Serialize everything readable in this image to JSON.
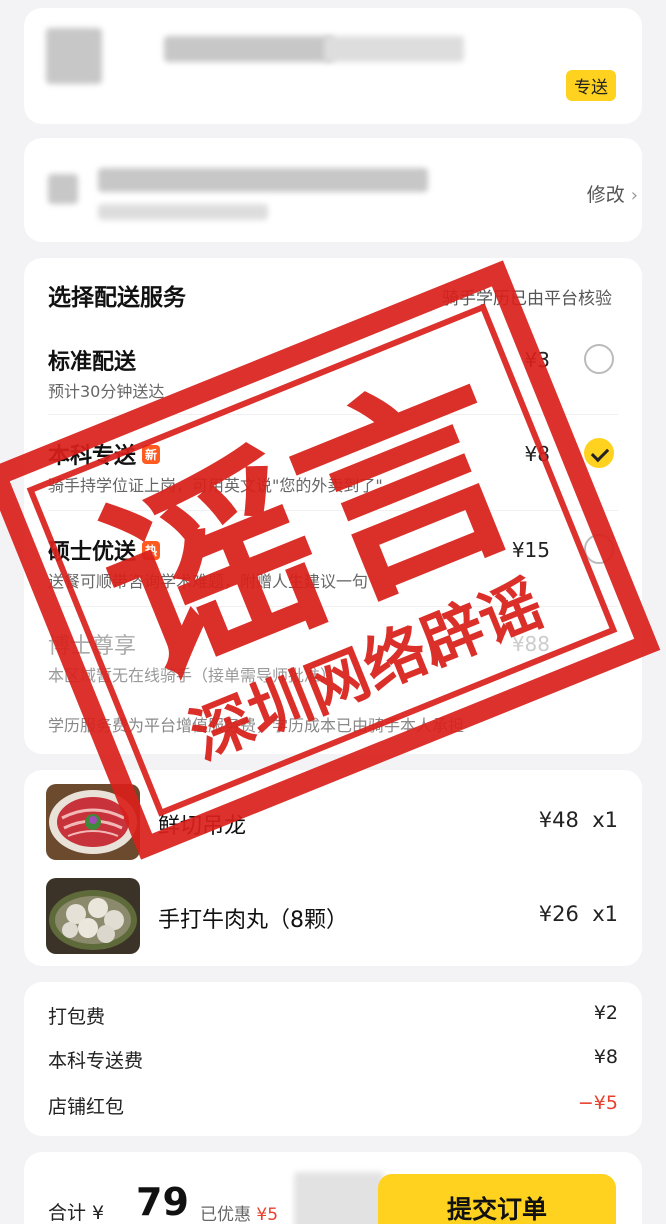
{
  "shop": {
    "tag": "专送"
  },
  "address": {
    "edit_label": "修改"
  },
  "delivery": {
    "title": "选择配送服务",
    "note": "骑手学历已由平台核验",
    "options": [
      {
        "name": "标准配送",
        "badge": "",
        "desc": "预计30分钟送达",
        "price": "¥3",
        "selected": false,
        "available": true
      },
      {
        "name": "本科专送",
        "badge": "新",
        "desc": "骑手持学位证上岗，可用英文说\"您的外卖到了\"",
        "price": "¥8",
        "selected": true,
        "available": true
      },
      {
        "name": "硕士优送",
        "badge": "热",
        "desc": "送餐可顺带咨询学术难题，附赠人生建议一句",
        "price": "¥15",
        "selected": false,
        "available": true
      },
      {
        "name": "博士尊享",
        "badge": "",
        "desc": "本区域暂无在线骑手（接单需导师批准）",
        "price": "¥88",
        "selected": false,
        "available": false
      }
    ],
    "footnote": "学历服务费为平台增值服务费，学历成本已由骑手本人承担"
  },
  "items": [
    {
      "name": "鲜切吊龙",
      "price": "¥48",
      "qty": "x1",
      "image": "sliced-beef-plate"
    },
    {
      "name": "手打牛肉丸（8颗）",
      "price": "¥26",
      "qty": "x1",
      "image": "beef-balls-plate"
    }
  ],
  "fees": [
    {
      "label": "打包费",
      "value": "¥2",
      "highlight": false
    },
    {
      "label": "本科专送费",
      "value": "¥8",
      "highlight": false
    },
    {
      "label": "店铺红包",
      "value": "−¥5",
      "highlight": true
    }
  ],
  "checkout": {
    "total_label": "合计 ¥",
    "total": "79",
    "saved_label": "已优惠",
    "saved_amount": "¥5",
    "submit_label": "提交订单"
  },
  "stamp": {
    "main_text": "谣言",
    "sub_text": "深圳网络辟谣",
    "color": "#d9201a"
  },
  "colors": {
    "accent": "#ffd21f",
    "discount": "#e8402d",
    "stamp": "#d9201a"
  }
}
